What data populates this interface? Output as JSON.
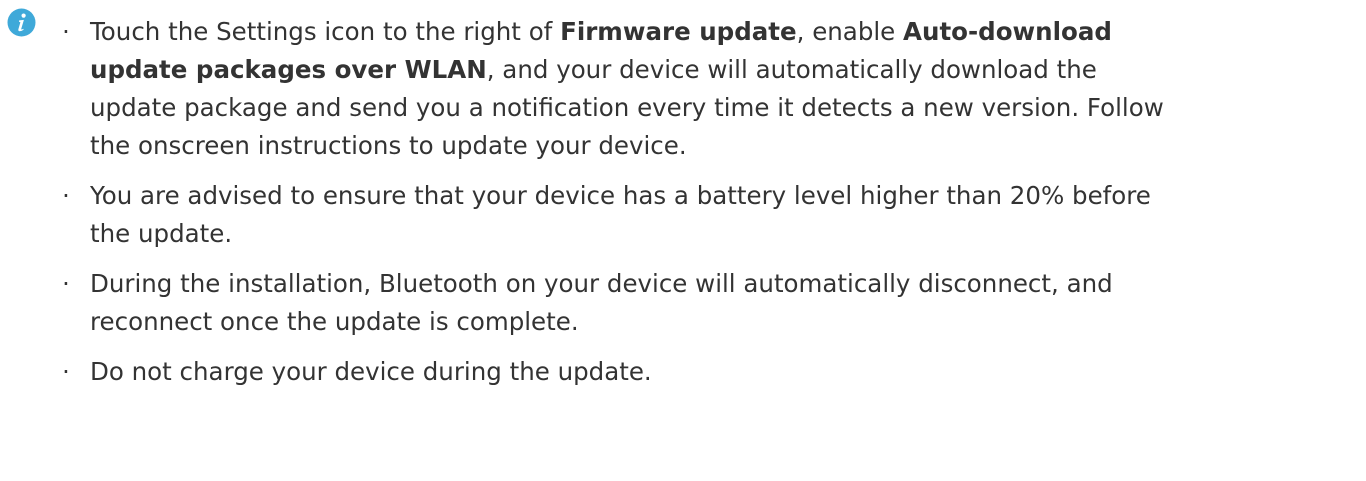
{
  "icon": {
    "name": "info-icon",
    "color": "#3fa9d9"
  },
  "notes": [
    {
      "lines": [
        [
          {
            "text": "Touch the Settings icon to the right of ",
            "bold": false
          },
          {
            "text": "Firmware update",
            "bold": true
          },
          {
            "text": ", enable ",
            "bold": false
          },
          {
            "text": "Auto-download",
            "bold": true
          }
        ],
        [
          {
            "text": "update packages over WLAN",
            "bold": true
          },
          {
            "text": ", and your device will automatically download the",
            "bold": false
          }
        ],
        [
          {
            "text": "update package and send you a notification every time it detects a new version. Follow",
            "bold": false
          }
        ],
        [
          {
            "text": "the onscreen instructions to update your device.",
            "bold": false
          }
        ]
      ]
    },
    {
      "lines": [
        [
          {
            "text": "You are advised to ensure that your device has a battery level higher than 20% before",
            "bold": false
          }
        ],
        [
          {
            "text": "the update.",
            "bold": false
          }
        ]
      ]
    },
    {
      "lines": [
        [
          {
            "text": "During the installation, Bluetooth on your device will automatically disconnect, and",
            "bold": false
          }
        ],
        [
          {
            "text": "reconnect once the update is complete.",
            "bold": false
          }
        ]
      ]
    },
    {
      "lines": [
        [
          {
            "text": "Do not charge your device during the update.",
            "bold": false
          }
        ]
      ]
    }
  ]
}
